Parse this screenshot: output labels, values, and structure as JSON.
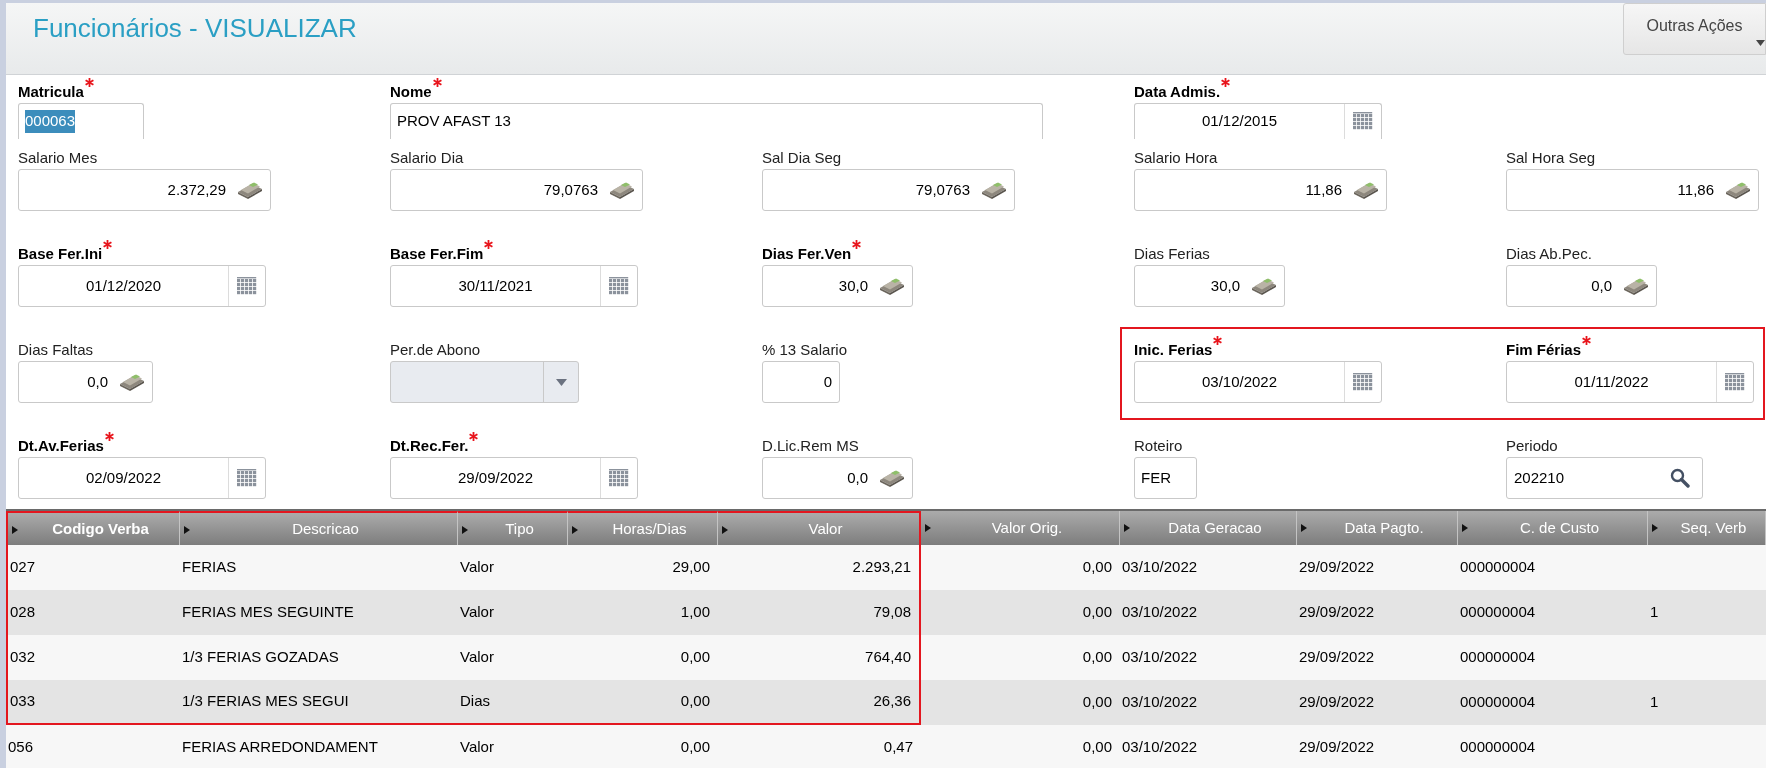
{
  "header": {
    "title": "Funcionários - VISUALIZAR",
    "actions_button": "Outras Ações"
  },
  "form": {
    "rows": [
      {
        "fields": [
          {
            "label": "Matricula",
            "required": true,
            "kind": "text",
            "value": "000063",
            "selected": true
          },
          {
            "label": "Nome",
            "required": true,
            "kind": "wide-text",
            "value": "PROV AFAST 13",
            "selected": false
          },
          {
            "label": "Data Admis.",
            "required": true,
            "kind": "date",
            "value": "01/12/2015",
            "selected": false
          }
        ]
      },
      {
        "fields": [
          {
            "label": "Salario Mes",
            "required": false,
            "kind": "money",
            "value": "2.372,29",
            "selected": false
          },
          {
            "label": "Salario Dia",
            "required": false,
            "kind": "money",
            "value": "79,0763",
            "selected": false
          },
          {
            "label": "Sal Dia Seg",
            "required": false,
            "kind": "money",
            "value": "79,0763",
            "selected": false
          },
          {
            "label": "Salario Hora",
            "required": false,
            "kind": "money",
            "value": "11,86",
            "selected": false
          },
          {
            "label": "Sal Hora Seg",
            "required": false,
            "kind": "money",
            "value": "11,86",
            "selected": false
          }
        ]
      },
      {
        "fields": [
          {
            "label": "Base Fer.Ini",
            "required": true,
            "kind": "date",
            "value": "01/12/2020",
            "selected": false
          },
          {
            "label": "Base Fer.Fim",
            "required": true,
            "kind": "date",
            "value": "30/11/2021",
            "selected": false
          },
          {
            "label": "Dias Fer.Ven",
            "required": true,
            "kind": "small-money",
            "value": "30,0",
            "selected": false
          },
          {
            "label": "Dias Ferias",
            "required": false,
            "kind": "small-money",
            "value": "30,0",
            "selected": false
          },
          {
            "label": "Dias Ab.Pec.",
            "required": false,
            "kind": "small-money",
            "value": "0,0",
            "selected": false
          }
        ]
      },
      {
        "fields": [
          {
            "label": "Dias Faltas",
            "required": false,
            "kind": "tiny-money",
            "value": "0,0",
            "selected": false
          },
          {
            "label": "Per.de Abono",
            "required": false,
            "kind": "select"
          },
          {
            "label": "% 13 Salario",
            "required": false,
            "kind": "number",
            "value": "0",
            "selected": false
          }
        ],
        "highlight_box": {
          "fields": [
            {
              "label": "Inic. Ferias",
              "required": true,
              "kind": "date",
              "value": "03/10/2022",
              "selected": false
            },
            {
              "label": "Fim Férias",
              "required": true,
              "kind": "date",
              "value": "01/11/2022",
              "selected": false
            }
          ]
        }
      },
      {
        "fields": [
          {
            "label": "Dt.Av.Ferias",
            "required": true,
            "kind": "date",
            "value": "02/09/2022",
            "selected": false
          },
          {
            "label": "Dt.Rec.Fer.",
            "required": true,
            "kind": "date",
            "value": "29/09/2022",
            "selected": false
          },
          {
            "label": "D.Lic.Rem MS",
            "required": false,
            "kind": "small-money",
            "value": "0,0",
            "selected": false
          },
          {
            "label": "Roteiro",
            "required": false,
            "kind": "code",
            "value": "FER",
            "selected": false
          },
          {
            "label": "Periodo",
            "required": false,
            "kind": "search",
            "value": "202210",
            "selected": false
          }
        ]
      }
    ]
  },
  "table": {
    "columns": [
      {
        "label": "Codigo Verba",
        "kind": "text",
        "sorted": true,
        "highlighted": true
      },
      {
        "label": "Descricao",
        "kind": "text",
        "sorted": false,
        "highlighted": true
      },
      {
        "label": "Tipo",
        "kind": "text",
        "sorted": false,
        "highlighted": true
      },
      {
        "label": "Horas/Dias",
        "kind": "number",
        "sorted": false,
        "highlighted": true
      },
      {
        "label": "Valor",
        "kind": "number",
        "sorted": false,
        "highlighted": true
      },
      {
        "label": "Valor Orig.",
        "kind": "number",
        "sorted": false,
        "highlighted": false
      },
      {
        "label": "Data Geracao",
        "kind": "text",
        "sorted": false,
        "highlighted": false
      },
      {
        "label": "Data Pagto.",
        "kind": "text",
        "sorted": false,
        "highlighted": false
      },
      {
        "label": "C. de Custo",
        "kind": "text",
        "sorted": false,
        "highlighted": false
      },
      {
        "label": "Seq. Verb",
        "kind": "text",
        "sorted": false,
        "highlighted": false
      }
    ],
    "rows": [
      {
        "highlighted": true,
        "cells": [
          "027",
          "FERIAS",
          "Valor",
          "29,00",
          "2.293,21",
          "0,00",
          "03/10/2022",
          "29/09/2022",
          "000000004",
          null
        ]
      },
      {
        "highlighted": true,
        "cells": [
          "028",
          "FERIAS MES SEGUINTE",
          "Valor",
          "1,00",
          "79,08",
          "0,00",
          "03/10/2022",
          "29/09/2022",
          "000000004",
          "1"
        ]
      },
      {
        "highlighted": true,
        "cells": [
          "032",
          "1/3 FERIAS GOZADAS",
          "Valor",
          "0,00",
          "764,40",
          "0,00",
          "03/10/2022",
          "29/09/2022",
          "000000004",
          null
        ]
      },
      {
        "highlighted": true,
        "cells": [
          "033",
          "1/3 FERIAS MES SEGUI",
          "Dias",
          "0,00",
          "26,36",
          "0,00",
          "03/10/2022",
          "29/09/2022",
          "000000004",
          "1"
        ]
      },
      {
        "highlighted": false,
        "cells": [
          "056",
          "FERIAS ARREDONDAMENT",
          "Valor",
          "0,00",
          "0,47",
          "0,00",
          "03/10/2022",
          "29/09/2022",
          "000000004",
          null
        ]
      }
    ]
  }
}
